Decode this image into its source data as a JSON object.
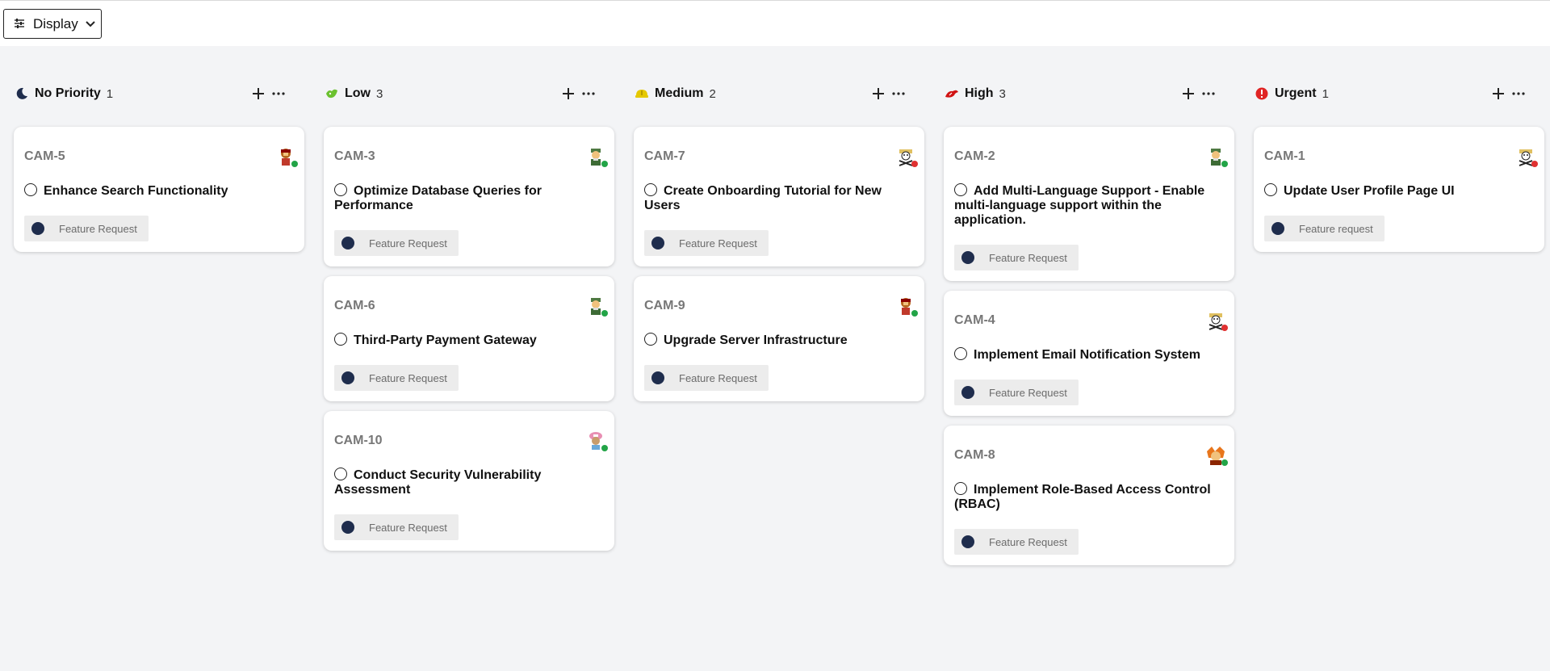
{
  "toolbar": {
    "display_label": "Display"
  },
  "columns": [
    {
      "title": "No Priority",
      "count": "1",
      "icon": "moon-icon",
      "cards": [
        {
          "id": "CAM-5",
          "title": "Enhance Search Functionality",
          "tag": "Feature Request",
          "status": "#22a447"
        }
      ]
    },
    {
      "title": "Low",
      "count": "3",
      "icon": "low-priority-icon",
      "cards": [
        {
          "id": "CAM-3",
          "title": "Optimize Database Queries for Performance",
          "tag": "Feature Request",
          "status": "#22a447"
        },
        {
          "id": "CAM-6",
          "title": "Third-Party Payment Gateway",
          "tag": "Feature Request",
          "status": "#22a447"
        },
        {
          "id": "CAM-10",
          "title": "Conduct Security Vulnerability Assessment",
          "tag": "Feature Request",
          "status": "#22a447"
        }
      ]
    },
    {
      "title": "Medium",
      "count": "2",
      "icon": "medium-priority-icon",
      "cards": [
        {
          "id": "CAM-7",
          "title": "Create Onboarding Tutorial for New Users",
          "tag": "Feature Request",
          "status": "#e03131"
        },
        {
          "id": "CAM-9",
          "title": "Upgrade Server Infrastructure",
          "tag": "Feature Request",
          "status": "#22a447"
        }
      ]
    },
    {
      "title": "High",
      "count": "3",
      "icon": "high-priority-icon",
      "cards": [
        {
          "id": "CAM-2",
          "title": "Add Multi-Language Support - Enable multi-language support within the application.",
          "tag": "Feature Request",
          "status": "#22a447"
        },
        {
          "id": "CAM-4",
          "title": "Implement Email Notification System",
          "tag": "Feature Request",
          "status": "#e03131"
        },
        {
          "id": "CAM-8",
          "title": "Implement Role-Based Access Control (RBAC)",
          "tag": "Feature Request",
          "status": "#22a447"
        }
      ]
    },
    {
      "title": "Urgent",
      "count": "1",
      "icon": "urgent-icon",
      "cards": [
        {
          "id": "CAM-1",
          "title": "Update User Profile Page UI",
          "tag": "Feature request",
          "status": "#e03131"
        }
      ]
    }
  ],
  "colors": {
    "tag_dot": "#1f2d4d",
    "low": "#6bc12f",
    "medium": "#e5c800",
    "high": "#d01313",
    "urgent": "#e02424",
    "moon": "#1f2d4d"
  }
}
